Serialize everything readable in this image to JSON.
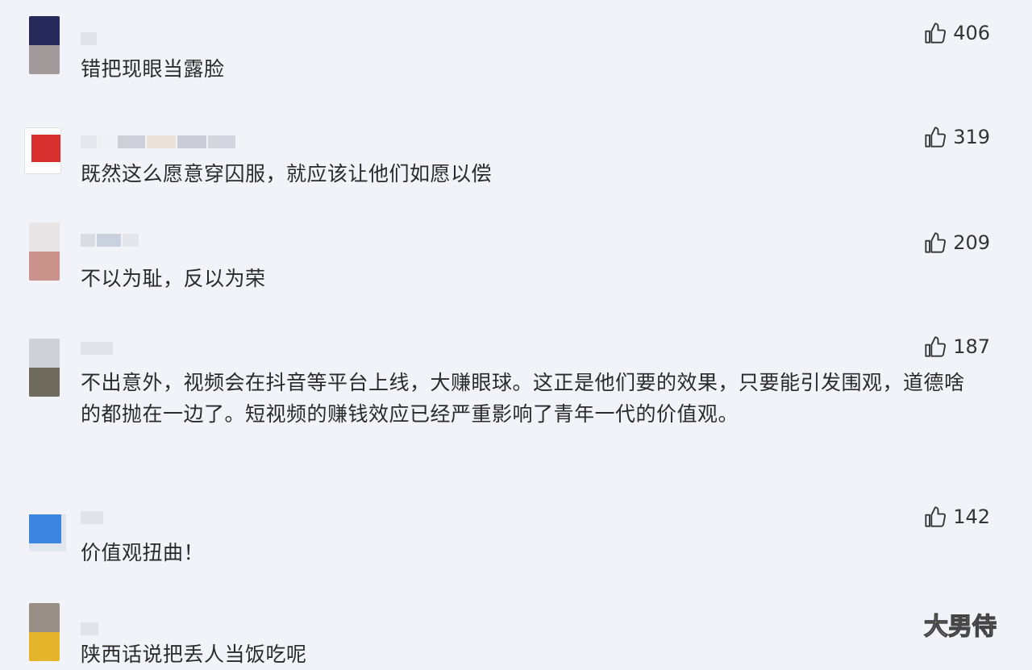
{
  "comments": [
    {
      "text": "错把现眼当露脸",
      "likes": "406",
      "avatar_colors": [
        "#262a5a",
        "#a39b9b"
      ]
    },
    {
      "text": "既然这么愿意穿囚服，就应该让他们如愿以偿",
      "likes": "319",
      "avatar_colors": [
        "#d8302e",
        "#d8302e"
      ]
    },
    {
      "text": "不以为耻，反以为荣",
      "likes": "209",
      "avatar_colors": [
        "#e8e4e6",
        "#c9928a"
      ]
    },
    {
      "text": "不出意外，视频会在抖音等平台上线，大赚眼球。这正是他们要的效果，只要能引发围观，道德啥的都抛在一边了。短视频的赚钱效应已经严重影响了青年一代的价值观。",
      "likes": "187",
      "avatar_colors": [
        "#cfd1d6",
        "#6e6a5e"
      ]
    },
    {
      "text": "价值观扭曲！",
      "likes": "142",
      "avatar_colors": [
        "#3a86e0",
        "#dfe6ee"
      ]
    },
    {
      "text": "陕西话说把丢人当饭吃呢",
      "likes": "",
      "avatar_colors": [
        "#9a8f86",
        "#e4b52a"
      ]
    }
  ],
  "watermark": "大男侍",
  "icons": {
    "like": "thumbs-up-icon"
  }
}
